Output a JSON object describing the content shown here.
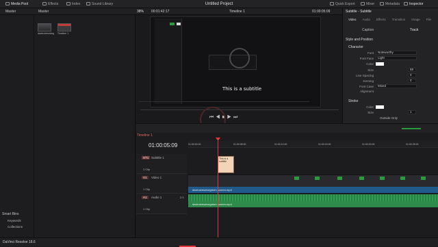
{
  "topbar": {
    "media_pool": "Media Pool",
    "effects": "Effects",
    "index": "Index",
    "sound_library": "Sound Library",
    "project_title": "Untitled Project",
    "quick_export": "Quick Export",
    "mixer": "Mixer",
    "metadata": "Metadata",
    "inspector": "Inspector"
  },
  "viewer_bar": {
    "zoom": "38%",
    "timecode_left": "00:01:42:17",
    "timeline_name": "Timeline 1",
    "timecode_right": "01:00:05:09",
    "duration_icon": "▾"
  },
  "media_pool": {
    "bin_header": "Master",
    "content_header": "Master",
    "items": [
      {
        "label": "davinciresolveg...",
        "color": "#8a8a8f"
      },
      {
        "label": "Timeline 1",
        "color": "#c13b3b"
      }
    ],
    "smart_bins": "Smart Bins",
    "keywords": "Keywords",
    "collections": "Collections"
  },
  "viewer": {
    "subtitle_text": "This is a subtitle"
  },
  "inspector": {
    "panel_title": "Subtitle - Subtitle",
    "tabs": [
      "Video",
      "Audio",
      "Effects",
      "Transition",
      "Image",
      "File"
    ],
    "subtabs": [
      "Caption",
      "Track"
    ],
    "section_style": "Style and Position",
    "section_character": "Character",
    "rows": [
      {
        "label": "Font",
        "value": "Noteworthy"
      },
      {
        "label": "Font Face",
        "value": "Light"
      },
      {
        "label": "Color",
        "value": ""
      },
      {
        "label": "Size",
        "value": "58"
      },
      {
        "label": "Line Spacing",
        "value": "0"
      },
      {
        "label": "Kerning",
        "value": "0"
      },
      {
        "label": "Font Case",
        "value": "Mixed"
      },
      {
        "label": "Alignment",
        "value": ""
      }
    ],
    "section_stroke": "Stroke",
    "stroke_rows": [
      {
        "label": "Color",
        "value": ""
      },
      {
        "label": "Size",
        "value": "1"
      }
    ],
    "stroke_mode": "Outside Only"
  },
  "timeline": {
    "tab_label": "Timeline 1",
    "timecode": "01:00:05:09",
    "ruler": [
      "01:00:00:00",
      "01:00:05:00",
      "01:00:10:00",
      "01:00:15:00",
      "01:00:20:00",
      "01:00:25:00"
    ],
    "tracks": [
      {
        "id": "ST1",
        "name": "Subtitle 1",
        "clips": "1 Clip"
      },
      {
        "id": "V1",
        "name": "Video 1",
        "clips": "1 Clip"
      },
      {
        "id": "A1",
        "name": "Audio 1",
        "clips": "1 Clip",
        "level": "2.0"
      }
    ],
    "subtitle_clip": "This is a subtitle",
    "video_clip_name": "davinciresolvegreen-screen.mp4",
    "audio_clip_name": "davinciresolvegreen-screen.mp4"
  },
  "bottom": {
    "app_name": "DaVinci Resolve 18.6"
  },
  "colors": {
    "accent_green": "#2d8a4a",
    "playhead": "#e0383c",
    "subtitle_clip": "#f2d4b8"
  }
}
